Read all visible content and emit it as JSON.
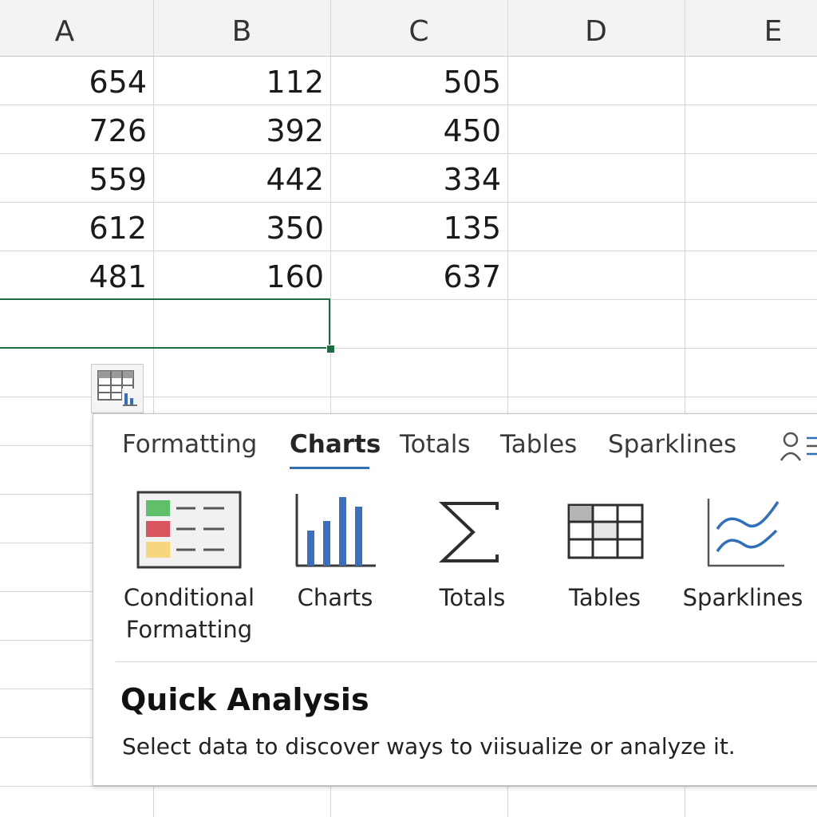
{
  "spreadsheet": {
    "columns": [
      "A",
      "B",
      "C",
      "D",
      "E"
    ],
    "rows": [
      [
        "654",
        "112",
        "505",
        "",
        ""
      ],
      [
        "726",
        "392",
        "450",
        "",
        ""
      ],
      [
        "559",
        "442",
        "334",
        "",
        ""
      ],
      [
        "612",
        "350",
        "135",
        "",
        ""
      ],
      [
        "481",
        "160",
        "637",
        "",
        ""
      ]
    ]
  },
  "quick_analysis_button": {
    "icon": "quick-analysis-icon"
  },
  "panel": {
    "tabs": [
      {
        "label": "Formatting",
        "active": false
      },
      {
        "label": "Charts",
        "active": true
      },
      {
        "label": "Totals",
        "active": false
      },
      {
        "label": "Tables",
        "active": false
      },
      {
        "label": "Sparklines",
        "active": false
      }
    ],
    "more_icon": "people-icon",
    "tiles": [
      {
        "label": "Conditional\nFormatting",
        "icon": "conditional-formatting-icon"
      },
      {
        "label": "Charts",
        "icon": "bar-chart-icon"
      },
      {
        "label": "Totals",
        "icon": "sigma-icon"
      },
      {
        "label": "Tables",
        "icon": "table-icon"
      },
      {
        "label": "Sparklines",
        "icon": "sparklines-icon"
      }
    ],
    "title": "Quick Analysis",
    "description": "Select data to discover ways to viisualize or analyze it."
  },
  "colors": {
    "selection": "#1f6b45",
    "accent": "#2f6fbd",
    "green": "#5fbf6a",
    "red": "#d9545e",
    "yellow": "#f7d77e"
  }
}
